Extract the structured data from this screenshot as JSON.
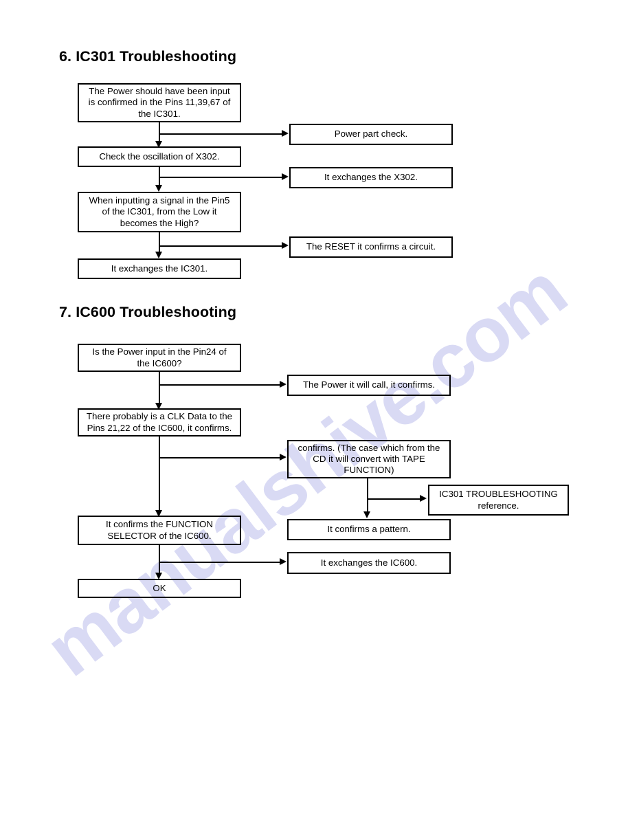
{
  "document": {
    "watermark": "manualshive.com",
    "watermark_color": "#d9daf4",
    "ink_color": "#000000",
    "page_background": "#ffffff"
  },
  "sections": [
    {
      "number": "6.",
      "heading": "6. IC301 Troubleshooting",
      "main_boxes": [
        {
          "id": "power-input-confirm",
          "text": "The Power should have been input\nis confirmed in the Pins 11,39,67 of\nthe IC301."
        },
        {
          "id": "check-oscillation-x302",
          "text": "Check the oscillation of X302."
        },
        {
          "id": "pin5-low-to-high",
          "text": "When inputting a signal in the Pin5\nof the IC301, from the Low it\nbecomes the High?"
        },
        {
          "id": "exchange-ic301",
          "text": "It exchanges the IC301."
        }
      ],
      "branch_boxes": [
        {
          "id": "power-part-check",
          "text": "Power part check."
        },
        {
          "id": "exchange-x302",
          "text": "It exchanges the X302."
        },
        {
          "id": "reset-confirm-circuit",
          "text": "The RESET it confirms a circuit."
        }
      ]
    },
    {
      "number": "7.",
      "heading": "7. IC600 Troubleshooting",
      "main_boxes": [
        {
          "id": "power-input-pin24",
          "text": "Is the Power input in the Pin24 of\nthe IC600?"
        },
        {
          "id": "clk-data-pins-21-22",
          "text": "There probably is a CLK Data to the\nPins 21,22 of the IC600, it confirms."
        },
        {
          "id": "confirm-function-selector",
          "text": "It confirms the FUNCTION\nSELECTOR of the IC600."
        },
        {
          "id": "ok",
          "text": "OK"
        }
      ],
      "branch_boxes": [
        {
          "id": "power-will-call-confirms",
          "text": "The Power it will call, it confirms."
        },
        {
          "id": "confirms-tape-function",
          "text": "confirms. (The case which from the\nCD it will convert with TAPE\nFUNCTION)"
        },
        {
          "id": "ic301-troubleshooting-reference",
          "text": "IC301 TROUBLESHOOTING\nreference."
        },
        {
          "id": "confirms-a-pattern",
          "text": "It confirms a pattern."
        },
        {
          "id": "exchange-ic600",
          "text": "It exchanges the IC600."
        }
      ]
    }
  ]
}
